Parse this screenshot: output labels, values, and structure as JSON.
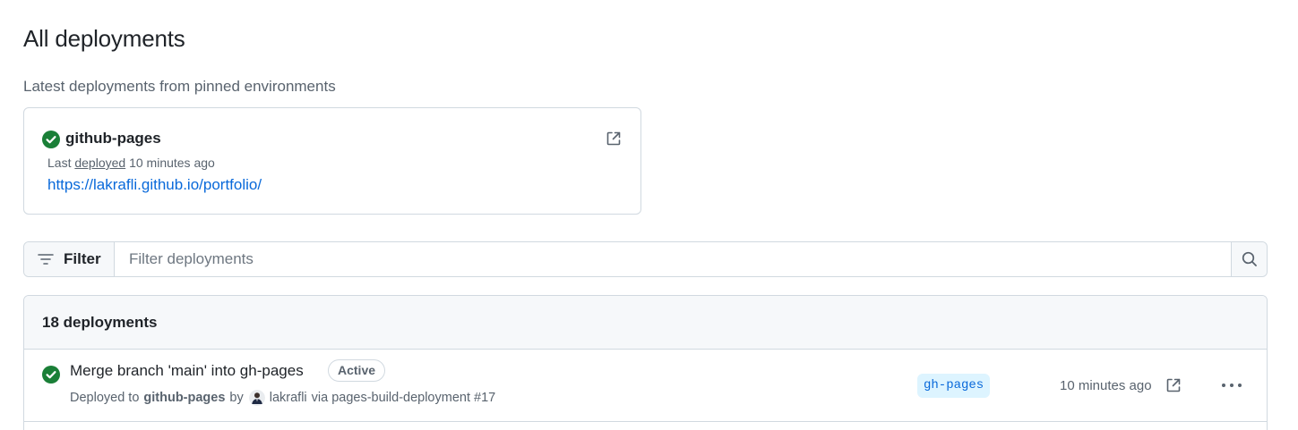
{
  "page": {
    "title": "All deployments"
  },
  "pinned": {
    "subtitle": "Latest deployments from pinned environments",
    "card": {
      "environment": "github-pages",
      "last_prefix": "Last",
      "deployed_link": "deployed",
      "time_ago": "10 minutes ago",
      "url": "https://lakrafli.github.io/portfolio/",
      "status_icon": "check-circle-fill-icon",
      "external_icon": "link-external-icon"
    }
  },
  "filter": {
    "button_label": "Filter",
    "placeholder": "Filter deployments",
    "value": "",
    "filter_icon": "filter-icon",
    "search_icon": "search-icon"
  },
  "deployments": {
    "count_label": "18 deployments",
    "rows": [
      {
        "title": "Merge branch 'main' into gh-pages",
        "badge": "Active",
        "deployed_to_text": "Deployed to",
        "environment": "github-pages",
        "by_text": "by",
        "user": "lakrafli",
        "via_text": "via pages-build-deployment #17",
        "branch": "gh-pages",
        "time_ago": "10 minutes ago",
        "status_icon": "check-circle-fill-icon",
        "external_icon": "link-external-icon",
        "more_icon": "kebab-horizontal-icon"
      }
    ]
  },
  "colors": {
    "success": "#1a7f37",
    "link": "#0969da",
    "muted": "#59636e",
    "border": "#d1d9e0",
    "header_bg": "#f6f8fa",
    "branch_bg": "#ddf4ff"
  }
}
